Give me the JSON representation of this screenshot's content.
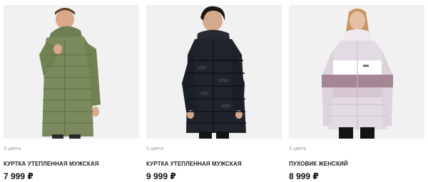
{
  "products": [
    {
      "colors_count": "3 цвета",
      "title": "КУРТКА УТЕПЛЕННАЯ МУЖСКАЯ",
      "price": "7 999 ₽",
      "jacket_color": "#7b8a5c",
      "image_desc": "olive-green-long-puffer-coat"
    },
    {
      "colors_count": "2 цвета",
      "title": "КУРТКА УТЕПЛЕННАЯ МУЖСКАЯ",
      "price": "9 999 ₽",
      "jacket_color": "#1f232b",
      "image_desc": "black-glossy-puffer-jacket"
    },
    {
      "colors_count": "3 цвета",
      "title": "ПУХОВИК ЖЕНСКИЙ",
      "price": "8 999 ₽",
      "jacket_color": "#e8e2e8",
      "image_desc": "lavender-white-colorblock-puffer"
    }
  ]
}
